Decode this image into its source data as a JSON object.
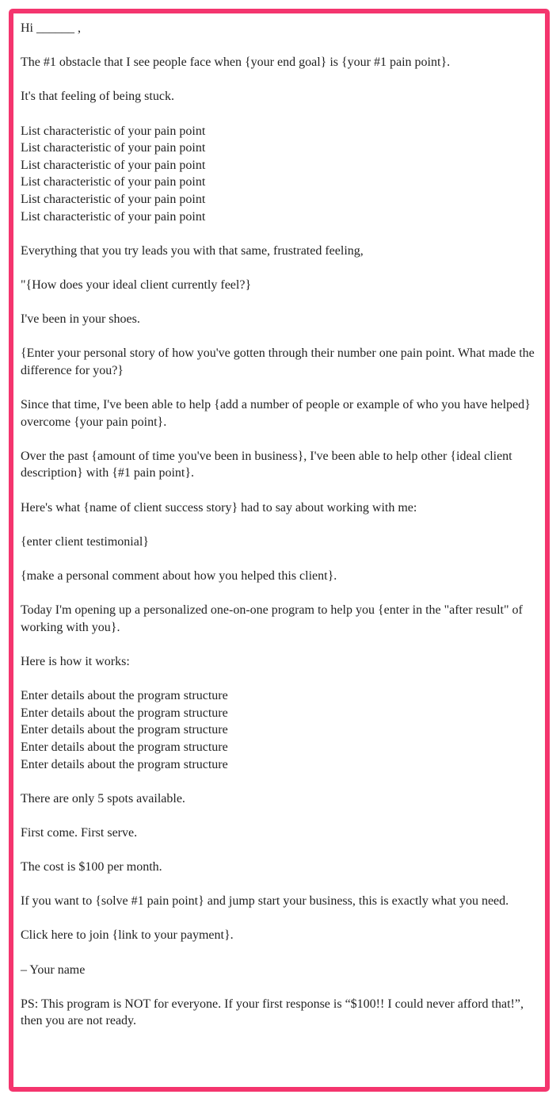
{
  "email": {
    "greeting": "Hi ______ ,",
    "obstacle": "The #1 obstacle that I see people face when {your end goal} is {your #1 pain point}.",
    "stuck": "It's that feeling of being stuck.",
    "pain_characteristics": [
      "List characteristic of your pain point",
      "List characteristic of your pain point",
      "List characteristic of your pain point",
      "List characteristic of your pain point",
      "List characteristic of your pain point",
      "List characteristic of your pain point"
    ],
    "everything": "Everything that you try leads you with that same, frustrated feeling,",
    "ideal_client_feel": "\"{How does your ideal client currently feel?}",
    "shoes": "I've been in your shoes.",
    "personal_story": "{Enter your personal story of how you've gotten through their number one pain point. What made the difference for you?}",
    "since_that_time": "Since that time, I've been able to help {add a number of people or example of who you have helped} overcome {your pain point}.",
    "over_the_past": "Over the past {amount of time you've been in business}, I've been able to help other {ideal client description} with {#1 pain point}.",
    "success_story_intro": "Here's what {name of client success story} had to say about working with me:",
    "testimonial": "{enter client testimonial}",
    "personal_comment": "{make a personal comment about how you helped this client}.",
    "today": "Today I'm opening up a personalized one-on-one program to help you {enter in the \"after result\" of working with you}.",
    "how_it_works": "Here is how it works:",
    "program_details": [
      "Enter details about the program structure",
      "Enter details about the program structure",
      "Enter details about the program structure",
      "Enter details about the program structure",
      "Enter details about the program structure"
    ],
    "spots": "There are only 5 spots available.",
    "first_come": "First come. First serve.",
    "cost": "The cost is $100 per month.",
    "if_you_want": "If you want to {solve #1 pain point} and jump start your business, this is exactly what you need.",
    "click_here": "Click here to join {link to your payment}.",
    "signature": "– Your name",
    "ps": "PS: This program is NOT for everyone. If your first response is “$100!! I could never afford that!”, then you are not ready."
  },
  "colors": {
    "border": "#f4356e",
    "text": "#222222",
    "background": "#ffffff"
  }
}
